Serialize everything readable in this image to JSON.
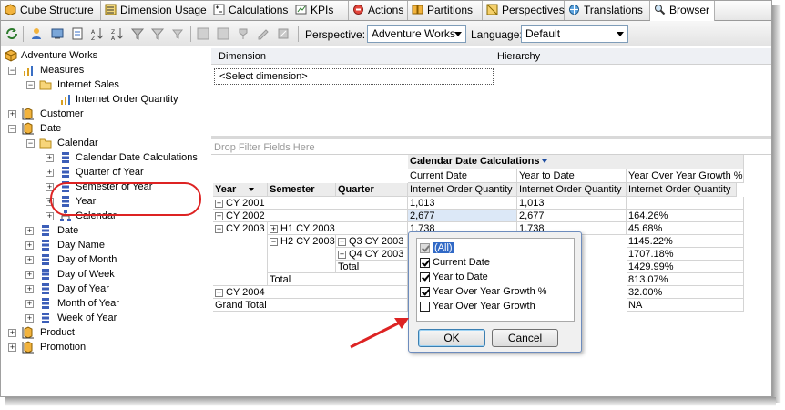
{
  "tabs": [
    {
      "label": "Cube Structure",
      "icon": "cube-structure-icon"
    },
    {
      "label": "Dimension Usage",
      "icon": "dimension-usage-icon"
    },
    {
      "label": "Calculations",
      "icon": "calculations-icon"
    },
    {
      "label": "KPIs",
      "icon": "kpi-icon"
    },
    {
      "label": "Actions",
      "icon": "actions-icon"
    },
    {
      "label": "Partitions",
      "icon": "partitions-icon"
    },
    {
      "label": "Perspectives",
      "icon": "perspectives-icon"
    },
    {
      "label": "Translations",
      "icon": "translations-icon"
    },
    {
      "label": "Browser",
      "icon": "browser-icon",
      "active": true
    }
  ],
  "toolbar": {
    "perspective_label": "Perspective:",
    "perspective_value": "Adventure Works",
    "language_label": "Language:",
    "language_value": "Default"
  },
  "tree": {
    "root": "Adventure Works",
    "measures": "Measures",
    "internet_sales": "Internet Sales",
    "internet_order_quantity": "Internet Order Quantity",
    "customer": "Customer",
    "date": "Date",
    "calendar": "Calendar",
    "calendar_date_calculations": "Calendar Date Calculations",
    "quarter_of_year": "Quarter of Year",
    "semester_of_year": "Semester of Year",
    "year": "Year",
    "calendar_hierarchy": "Calendar",
    "date_attr": "Date",
    "day_name": "Day Name",
    "day_of_month": "Day of Month",
    "day_of_week": "Day of Week",
    "day_of_year": "Day of Year",
    "month_of_year": "Month of Year",
    "week_of_year": "Week of Year",
    "product": "Product",
    "promotion": "Promotion"
  },
  "filter_pane": {
    "col_dimension": "Dimension",
    "col_hierarchy": "Hierarchy",
    "select_dimension": "<Select dimension>"
  },
  "pivot": {
    "drop_filter_hint": "Drop Filter Fields Here",
    "column_field": "Calendar Date Calculations",
    "columns": [
      "Current Date",
      "Year to Date",
      "Year Over Year Growth %"
    ],
    "measure": "Internet Order Quantity",
    "row_headers": [
      "Year",
      "Semester",
      "Quarter"
    ],
    "rows": {
      "cy2001": "CY 2001",
      "cy2002": "CY 2002",
      "cy2003": "CY 2003",
      "h1cy2003": "H1 CY 2003",
      "h2cy2003": "H2 CY 2003",
      "q3cy2003": "Q3 CY 2003",
      "q4cy2003": "Q4 CY 2003",
      "total_h2": "Total",
      "total_cy2003": "Total",
      "cy2004": "CY 2004",
      "grand_total": "Grand Total"
    },
    "values": {
      "cy2001_current": "1,013",
      "cy2001_ytd": "1,013",
      "cy2002_current": "2,677",
      "cy2002_ytd": "2,677",
      "cy2002_yoy": "164.26%",
      "h1_current": "1,738",
      "h1_ytd": "1,738",
      "h1_yoy": "45.68%",
      "q3_yoy": "1145.22%",
      "q4_yoy": "1707.18%",
      "totalh2_yoy": "1429.99%",
      "totalcy2003_yoy": "813.07%",
      "cy2004_yoy": "32.00%",
      "grand_yoy": "NA"
    }
  },
  "popup": {
    "items": [
      {
        "label": "(All)",
        "checked": true
      },
      {
        "label": "Current Date",
        "checked": true
      },
      {
        "label": "Year to Date",
        "checked": true
      },
      {
        "label": "Year Over Year Growth %",
        "checked": true
      },
      {
        "label": "Year Over Year Growth",
        "checked": false
      }
    ],
    "ok_label": "OK",
    "cancel_label": "Cancel"
  },
  "colors": {
    "callout_red": "#dd2323",
    "selection_blue": "#3169c6",
    "header_gray": "#ececec"
  }
}
